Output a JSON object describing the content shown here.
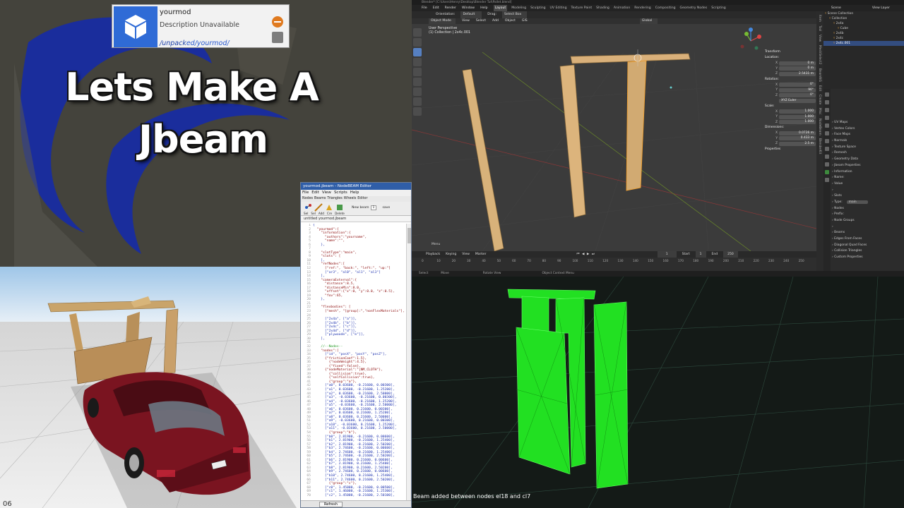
{
  "title_panel": {
    "line1": "Lets Make A",
    "line2": "Jbeam",
    "colors": {
      "swirl": "#1a2d9c",
      "background": "#44433c"
    }
  },
  "mod_card": {
    "name": "yourmod",
    "description": "Description Unavailable",
    "path_prefix": "/unpack",
    "path_rest": "ed/yourmod/",
    "logo_icon": "box-icon",
    "disable_icon": "minus-circle-icon",
    "pack_icon": "package-icon"
  },
  "sim_view": {
    "footer_number": "06",
    "vehicle_color": "#7a1420"
  },
  "editor": {
    "title": "yourmod.jbeam - NodeBEAM Editor",
    "menu": [
      "File",
      "Edit",
      "View",
      "Scripts",
      "Help"
    ],
    "tabs": [
      "Nodes",
      "Beams",
      "Triangles",
      "Wheels",
      "Editor"
    ],
    "toolbar": [
      "Sel",
      "Sel",
      "Add",
      "Cre",
      "Delete"
    ],
    "new_beam_label": "New beam",
    "new_beam_value": "1",
    "dropdown_label": "save",
    "file_tab": "untitled yourmod.jbeam",
    "code_lines": [
      "{",
      "  \"yourmod\":{",
      "    \"information\":{",
      "      \"authors\":\"yourname\",",
      "      \"name\":\"\",",
      "    },",
      "",
      "    \"slotType\":\"main\",",
      "    \"slots\": [",
      "    ],",
      "    \"refNodes\":[",
      "      [\"ref:\", \"back:\", \"left:\", \"up:\"]",
      "      [\"ar3\", \"al0\", \"al1\", \"al3\"]",
      "    ],",
      "    \"cameraExternal\":{",
      "      \"distance\":8.5,",
      "      \"distanceMin\":8.0,",
      "      \"offset\":{\"x\":0, \"y\":0.0, \"z\":0.5},",
      "      \"fov\":65,",
      "    },",
      "",
      "    \"flexbodies\": [",
      "      [\"mesh\", \"[group]:\",\"nonFlexMaterials\"],",
      "",
      "      [\"2x4a\", [\"a\"]],",
      "      [\"2x4b\", [\"b\"]],",
      "      [\"2x4c\", [\"c\"]],",
      "      [\"2x4d\", [\"d\"]],",
      "      [\"plywoode\", [\"e\"]],",
      "    ],",
      "",
      "    //--Nodes--",
      "    \"nodes\":[",
      "      [\"id\", \"posX\", \"posY\", \"posZ\"],",
      "      {\"frictionCoef\":1.5},",
      "        {\"nodeWeight\":4.5},",
      "        {\"fixed\":false},",
      "      {\"nodeMaterial\":\"|NM_CLOTH\"},",
      "        {\"collision\":true},",
      "        {\"selfCollision\":true},",
      "        {\"group\":\"a\"},",
      "      [\"a0\", 0.03600, -0.21600, 0.00300],",
      "      [\"a1\", 0.03600, -0.21600, 1.25200],",
      "      [\"a2\", 0.03600, -0.21600, 2.50000],",
      "      [\"a3\", -0.03600, -0.21600, 0.00300],",
      "      [\"a4\", -0.03600, -0.21600, 1.25200],",
      "      [\"a5\", -0.03600, -0.21600, 2.50000],",
      "      [\"a6\", 0.03600, 0.21600, 0.00300],",
      "      [\"a7\", 0.03600, 0.21600, 1.25200],",
      "      [\"a8\", 0.03600, 0.21600, 2.50000],",
      "      [\"a9\", -0.03600, 0.21600, 0.00300],",
      "      [\"a10\", -0.03600, 0.21600, 1.25200],",
      "      [\"a11\", -0.03600, 0.21600, 2.50000],",
      "        {\"group\":\"b\"},",
      "      [\"b0\", 2.81900, -0.21600, 0.00600],",
      "      [\"b1\", 2.81900, -0.21600, 1.25400],",
      "      [\"b2\", 2.81900, -0.21600, 2.50200],",
      "      [\"b3\", 2.74600, -0.21600, 0.00600],",
      "      [\"b4\", 2.74600, -0.21600, 1.25400],",
      "      [\"b5\", 2.74600, -0.21600, 2.50200],",
      "      [\"b6\", 2.81900, 0.21600, 0.00600],",
      "      [\"b7\", 2.81900, 0.21600, 1.25400],",
      "      [\"b8\", 2.81900, 0.21600, 2.50200],",
      "      [\"b9\", 2.74600, 0.21600, 0.00600],",
      "      [\"b10\", 2.74600, 0.21600, 1.25400],",
      "      [\"b11\", 2.74600, 0.21600, 2.50200],",
      "        {\"group\":\"c\"},",
      "      [\"c0\", 1.45000, -0.21600, 0.00500],",
      "      [\"c1\", 1.46000, -0.21600, 1.25300],",
      "      [\"c2\", 1.45000, -0.21600, 2.50100],"
    ],
    "refresh_label": "Refresh"
  },
  "blender": {
    "topbar": "Blender* [C:\\Users\\Henry\\Desktop\\Blender Tut\\Pallet.blend]",
    "menu": [
      "File",
      "Edit",
      "Render",
      "Window",
      "Help"
    ],
    "workspaces": [
      "Layout",
      "Modeling",
      "Sculpting",
      "UV Editing",
      "Texture Paint",
      "Shading",
      "Animation",
      "Rendering",
      "Compositing",
      "Geometry Nodes",
      "Scripting"
    ],
    "active_workspace": "Layout",
    "scene_label": "Scene",
    "view_layer_label": "View Layer",
    "header": [
      "Orientation:",
      "Default",
      "Drag:",
      "Select Box"
    ],
    "mode_bar": [
      "Object Mode",
      "View",
      "Select",
      "Add",
      "Object",
      "GIS"
    ],
    "global_label": "Global",
    "viewport_label_1": "User Perspective",
    "viewport_label_2": "(1) Collection | 2x4c.001",
    "transform": {
      "heading": "Transform",
      "location_label": "Location:",
      "location": [
        "0 m",
        "0 m",
        "2.5431 m"
      ],
      "rotation_label": "Rotation:",
      "rotation": [
        "0°",
        "90°",
        "0°"
      ],
      "rotation_mode": "XYZ Euler",
      "scale_label": "Scale:",
      "scale": [
        "1.000",
        "1.000",
        "1.000"
      ],
      "dimensions_label": "Dimensions:",
      "dimensions": [
        "0.0726 m",
        "0.433 m",
        "2.5 m"
      ],
      "properties_label": "Properties"
    },
    "axis_labels": [
      "X",
      "Y",
      "Z"
    ],
    "sidetabs": [
      "Item",
      "Tool",
      "View",
      "MeshSelect2",
      "BeamNG",
      "Edit",
      "Create",
      "Misc",
      "NodeBeam",
      "BlenderKit"
    ],
    "outliner": [
      {
        "label": "Scene Collection",
        "sel": false
      },
      {
        "label": "Collection",
        "sel": false
      },
      {
        "label": "2x4a",
        "sel": false
      },
      {
        "label": "Cube",
        "sel": false
      },
      {
        "label": "2x4b",
        "sel": false
      },
      {
        "label": "2x4c",
        "sel": false
      },
      {
        "label": "2x4c.001",
        "sel": true
      }
    ],
    "props": [
      "UV Maps",
      "Vertex Colors",
      "Face Maps",
      "Normals",
      "Texture Space",
      "Remesh",
      "Geometry Data",
      "Jbeam Properties",
      "Information",
      "Name:",
      "Value",
      "",
      "Slots",
      "Type:",
      "Nodes",
      "Prefix:",
      "Node Groups",
      "",
      "Beams",
      "Edges From Faces",
      "Diagonal Quad Faces",
      "Collision Triangles",
      "Custom Properties"
    ],
    "type_value": "main",
    "timeline_menu": [
      "Playback",
      "Keying",
      "View",
      "Marker"
    ],
    "timeline_start_label": "Start",
    "timeline_start": "1",
    "timeline_end_label": "End",
    "timeline_end": "250",
    "timeline_current": "1",
    "timeline_ticks": [
      "0",
      "10",
      "20",
      "30",
      "40",
      "50",
      "60",
      "70",
      "80",
      "90",
      "100",
      "110",
      "120",
      "130",
      "140",
      "150",
      "160",
      "170",
      "180",
      "190",
      "200",
      "210",
      "220",
      "230",
      "240",
      "250"
    ],
    "status": [
      "Select",
      "Move",
      "Rotate View",
      "Object Context Menu"
    ],
    "menu_hint": "Menu"
  },
  "debug_view": {
    "message": "Beam added between nodes el18 and cl7",
    "mesh_color": "#22ff22"
  }
}
